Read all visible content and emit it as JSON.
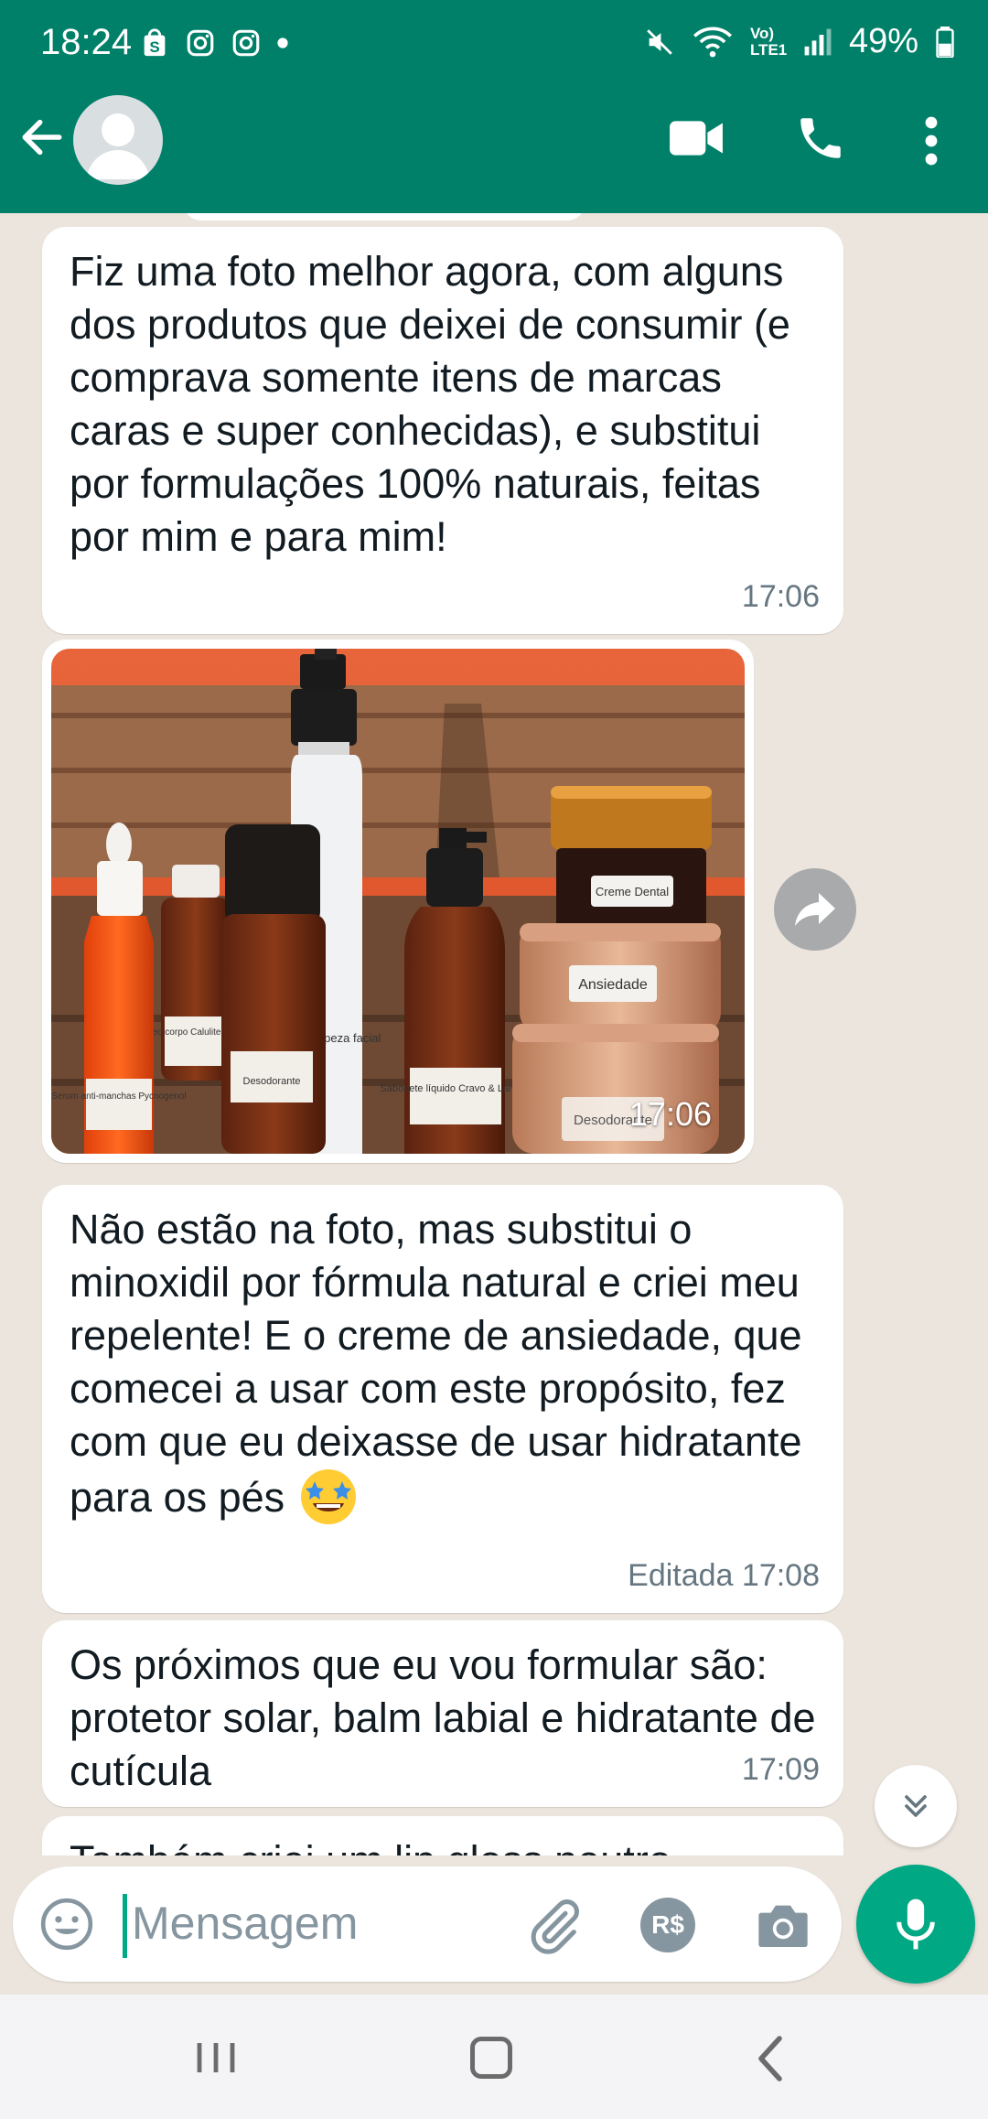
{
  "status_bar": {
    "time": "18:24",
    "battery": "49%",
    "network": "Vo) LTE1"
  },
  "header": {
    "back_icon": "arrow-left-icon",
    "avatar_icon": "default-avatar-icon",
    "actions": [
      "video-call-icon",
      "voice-call-icon",
      "more-vert-icon"
    ]
  },
  "messages": [
    {
      "text": "Fiz uma foto melhor agora, com alguns dos produtos que deixei de consumir (e comprava somente itens de marcas caras e super conhecidas), e substitui por formulações 100% naturais, feitas por mim e para mim!",
      "time": "17:06"
    },
    {
      "type": "image",
      "time": "17:06",
      "labels": {
        "serum": "Serum anti-manchas Pycnogenol",
        "oleo": "Óleo corpo Calulite & Fle",
        "desodorante_bottle": "Desodorante",
        "gel": "Gel de limpeza facial",
        "sabonete": "Sabonete líquido Cravo & Laranja",
        "creme": "Creme Dental",
        "ansiedade": "Ansiedade",
        "desodorante_jar": "Desodorante"
      }
    },
    {
      "text": "Não estão na foto, mas substitui o minoxidil por fórmula natural e criei meu repelente! E o creme de ansiedade, que comecei a usar com este propósito, fez com que eu deixasse de usar hidratante para os pés",
      "emoji": "🤩",
      "time": "Editada 17:08"
    },
    {
      "text": "Os próximos que eu vou formular são: protetor solar, balm labial e hidratante de cutícula",
      "time": "17:09"
    },
    {
      "text": "Também criei um lip gloss neutro",
      "time": ""
    }
  ],
  "composer": {
    "placeholder": "Mensagem",
    "pay_label": "R$"
  }
}
